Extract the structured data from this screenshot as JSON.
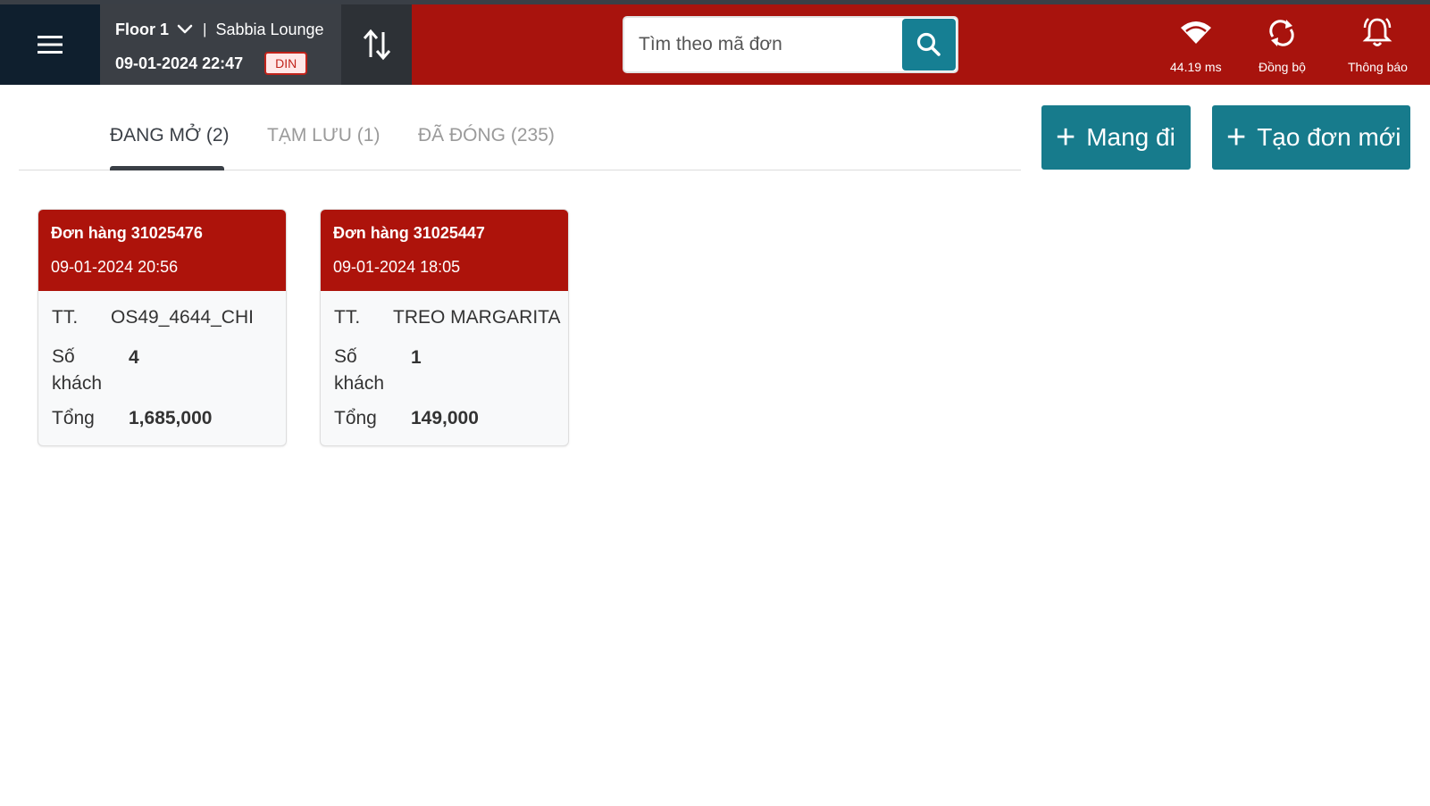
{
  "header": {
    "floor": "Floor 1",
    "separator": "|",
    "location": "Sabbia Lounge",
    "datetime": "09-01-2024 22:47",
    "mode_badge": "DIN",
    "search": {
      "placeholder": "Tìm theo mã đơn",
      "value": ""
    },
    "stats": [
      {
        "icon": "wifi-icon",
        "label": "44.19 ms"
      },
      {
        "icon": "sync-icon",
        "label": "Đồng bộ"
      },
      {
        "icon": "bell-icon",
        "label": "Thông báo"
      }
    ]
  },
  "tabs": [
    {
      "label": "ĐANG MỞ (2)",
      "active": true
    },
    {
      "label": "TẠM LƯU (1)",
      "active": false
    },
    {
      "label": "ĐÃ ĐÓNG (235)",
      "active": false
    }
  ],
  "actions": {
    "plus": "+",
    "takeaway_label": "Mang đi",
    "new_order_label": "Tạo đơn mới"
  },
  "orders": [
    {
      "title": "Đơn hàng 31025476",
      "time": "09-01-2024 20:56",
      "tt_label": "TT.",
      "tt_value": "OS49_4644_CHI",
      "guests_label_1": "Số",
      "guests_label_2": "khách",
      "guests_value": "4",
      "total_label": "Tổng",
      "total_value": "1,685,000"
    },
    {
      "title": "Đơn hàng 31025447",
      "time": "09-01-2024 18:05",
      "tt_label": "TT.",
      "tt_value": "TREO MARGARITA",
      "guests_label_1": "Số",
      "guests_label_2": "khách",
      "guests_value": "1",
      "total_label": "Tổng",
      "total_value": "149,000"
    }
  ],
  "colors": {
    "header_red": "#a8130d",
    "card_head_red": "#ad130b",
    "teal": "#177b8c",
    "dark_navy": "#0f1f2e",
    "dark_gray": "#3b3f45"
  }
}
